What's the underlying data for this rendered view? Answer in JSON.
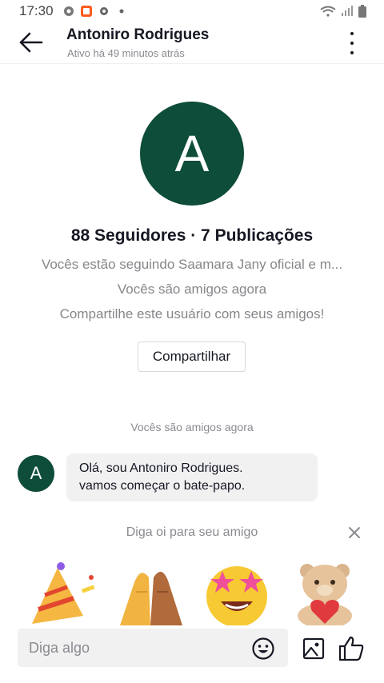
{
  "status_bar": {
    "time": "17:30"
  },
  "header": {
    "name": "Antoniro Rodrigues",
    "status": "Ativo há 49 minutos atrás"
  },
  "profile": {
    "avatar_letter": "A",
    "stats": "88 Seguidores · 7 Publicações",
    "info_lines": [
      "Vocês estão seguindo Saamara Jany oficial e m...",
      "Vocês são amigos agora",
      "Compartilhe este usuário com seus amigos!"
    ],
    "share_label": "Compartilhar"
  },
  "chat": {
    "system_message": "Vocês são amigos agora",
    "message": {
      "avatar_letter": "A",
      "line1": "Olá, sou Antoniro Rodrigues.",
      "line2": "vamos começar o bate-papo."
    }
  },
  "greeting": {
    "text": "Diga oi para seu amigo",
    "stickers": [
      "party-popper-sticker",
      "high-five-sticker",
      "star-eyes-sticker",
      "teddy-bear-heart-sticker"
    ]
  },
  "input": {
    "placeholder": "Diga algo"
  },
  "colors": {
    "avatar_bg": "#0e4d3a",
    "bubble_bg": "#f1f1f2",
    "muted_text": "#8a8b91"
  }
}
